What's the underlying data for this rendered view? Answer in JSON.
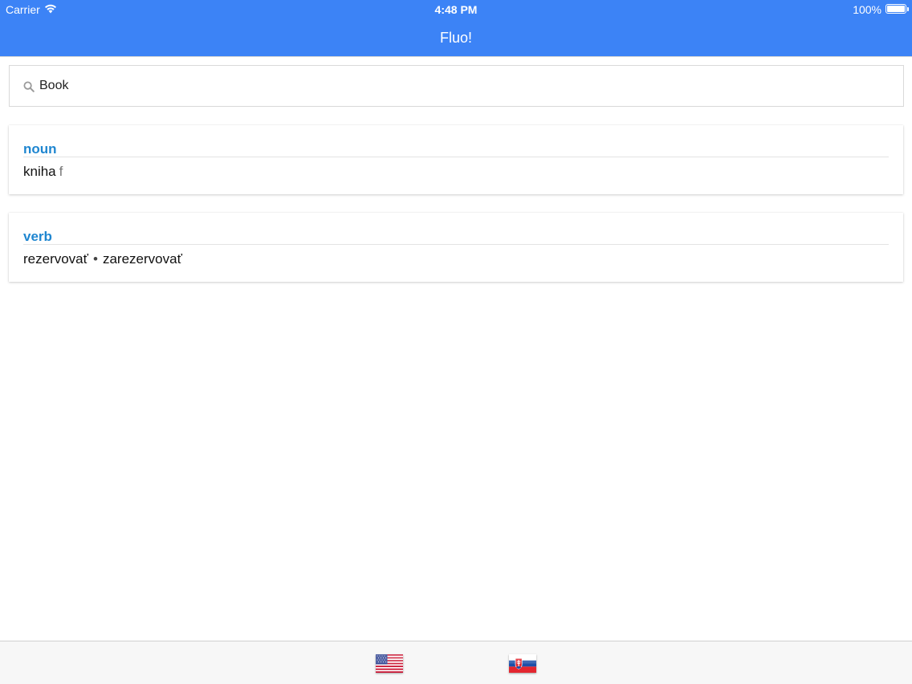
{
  "status_bar": {
    "carrier": "Carrier",
    "time": "4:48 PM",
    "battery": "100%"
  },
  "nav": {
    "title": "Fluo!"
  },
  "search": {
    "value": "Book",
    "icon": "search-icon"
  },
  "results": [
    {
      "part_of_speech": "noun",
      "translations": [
        {
          "word": "kniha",
          "gender": "f"
        }
      ]
    },
    {
      "part_of_speech": "verb",
      "separator": "•",
      "translations": [
        {
          "word": "rezervovať"
        },
        {
          "word": "zarezervovať"
        }
      ]
    }
  ],
  "tabbar": {
    "items": [
      {
        "icon": "us-flag-icon"
      },
      {
        "icon": "slovakia-flag-icon"
      }
    ]
  },
  "colors": {
    "nav_background": "#3c83f6",
    "part_of_speech": "#1f86d0"
  }
}
